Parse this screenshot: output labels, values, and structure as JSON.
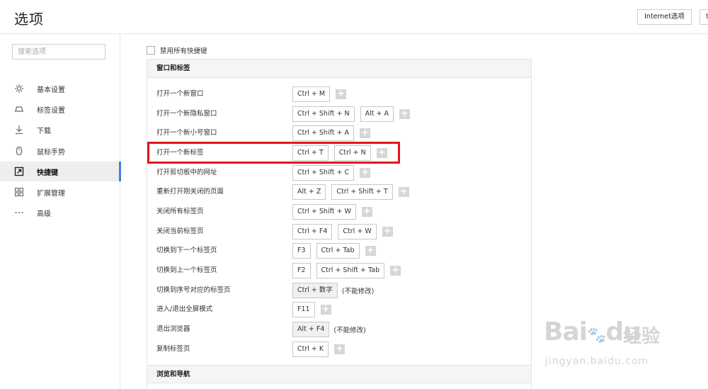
{
  "header": {
    "title": "选项",
    "internet_options_label": "Internet选项",
    "extra_button_label": "t"
  },
  "sidebar": {
    "search_placeholder": "搜索选项",
    "items": [
      {
        "label": "基本设置",
        "icon": "gear-icon"
      },
      {
        "label": "标签设置",
        "icon": "tab-icon"
      },
      {
        "label": "下载",
        "icon": "download-icon"
      },
      {
        "label": "鼠标手势",
        "icon": "mouse-icon"
      },
      {
        "label": "快捷键",
        "icon": "shortcut-icon",
        "active": true
      },
      {
        "label": "扩展管理",
        "icon": "extensions-icon"
      },
      {
        "label": "高级",
        "icon": "more-icon"
      }
    ]
  },
  "main": {
    "disable_all_label": "禁用所有快捷键",
    "section_window_tabs": "窗口和标签",
    "section_browse_nav": "浏览和导航",
    "not_modifiable": "(不能修改)",
    "add_symbol": "+",
    "shortcuts": [
      {
        "action": "打开一个新窗口",
        "keys": [
          "Ctrl + M"
        ]
      },
      {
        "action": "打开一个新隐私窗口",
        "keys": [
          "Ctrl + Shift + N",
          "Alt + A"
        ]
      },
      {
        "action": "打开一个新小号窗口",
        "keys": [
          "Ctrl + Shift + A"
        ]
      },
      {
        "action": "打开一个新标签",
        "keys": [
          "Ctrl + T",
          "Ctrl + N"
        ]
      },
      {
        "action": "打开剪切板中的网址",
        "keys": [
          "Ctrl + Shift + C"
        ]
      },
      {
        "action": "重新打开刚关闭的页面",
        "keys": [
          "Alt + Z",
          "Ctrl + Shift + T"
        ]
      },
      {
        "action": "关闭所有标签页",
        "keys": [
          "Ctrl + Shift + W"
        ]
      },
      {
        "action": "关闭当前标签页",
        "keys": [
          "Ctrl + F4",
          "Ctrl + W"
        ]
      },
      {
        "action": "切换到下一个标签页",
        "keys": [
          "F3",
          "Ctrl + Tab"
        ]
      },
      {
        "action": "切换到上一个标签页",
        "keys": [
          "F2",
          "Ctrl + Shift + Tab"
        ]
      },
      {
        "action": "切换到序号对应的标签页",
        "keys": [
          "Ctrl + 数字"
        ],
        "fixed": true
      },
      {
        "action": "进入/退出全屏模式",
        "keys": [
          "F11"
        ]
      },
      {
        "action": "退出浏览器",
        "keys": [
          "Alt + F4"
        ],
        "fixed": true
      },
      {
        "action": "复制标签页",
        "keys": [
          "Ctrl + K"
        ]
      }
    ]
  },
  "watermark": {
    "brand": "Bai",
    "brand_suffix": "du",
    "text": "经验",
    "url": "jingyan.baidu.com"
  },
  "colors": {
    "accent": "#3c86d8",
    "highlight": "#e3161c",
    "border": "#e3e3e3"
  }
}
